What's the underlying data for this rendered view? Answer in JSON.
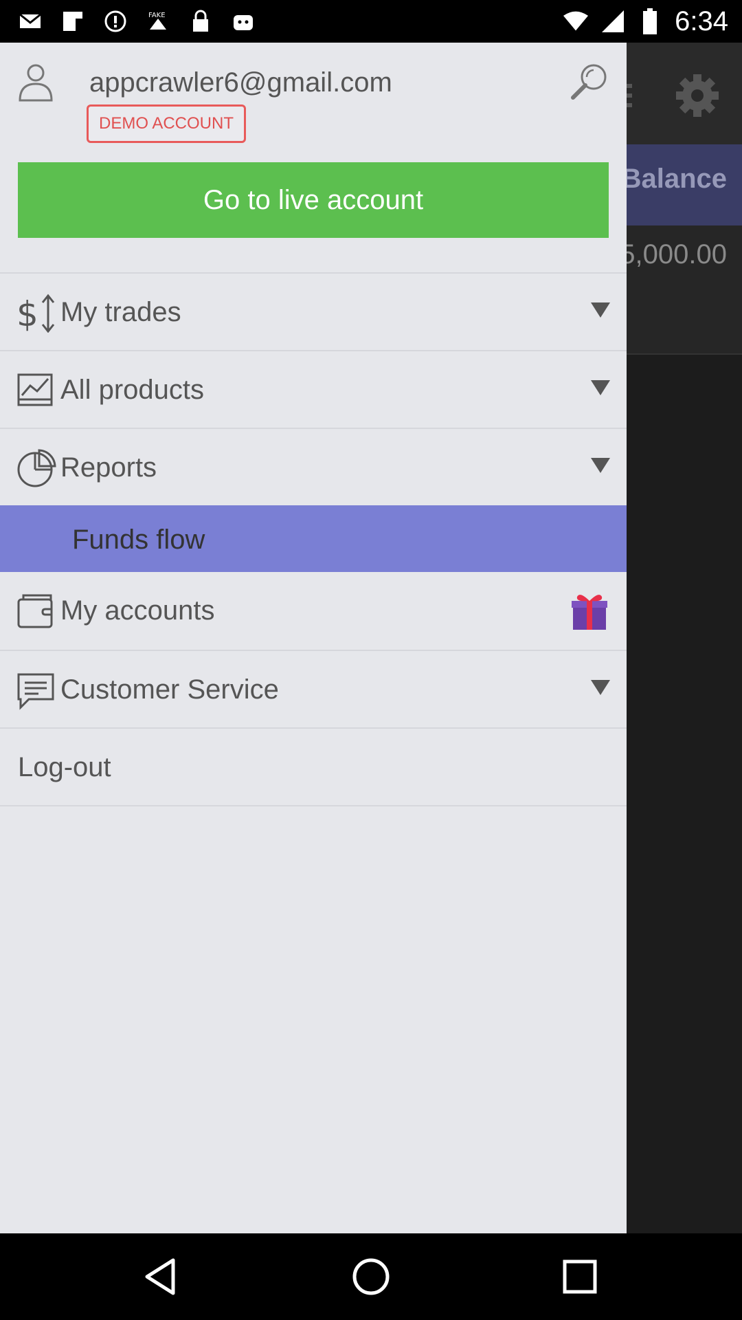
{
  "status_bar": {
    "time": "6:34",
    "icons": [
      "mail-icon",
      "flipboard-icon",
      "alert-icon",
      "fake-gps-icon",
      "lock-icon",
      "android-icon",
      "wifi-icon",
      "signal-icon",
      "battery-icon"
    ]
  },
  "background_app": {
    "balance_label": "Balance",
    "balance_value": "5,000.00"
  },
  "drawer": {
    "email": "appcrawler6@gmail.com",
    "account_badge": "DEMO ACCOUNT",
    "live_button": "Go to live account",
    "items": [
      {
        "label": "My trades",
        "icon": "dollar-updown-icon",
        "trailing": "caret"
      },
      {
        "label": "All products",
        "icon": "chart-icon",
        "trailing": "caret"
      },
      {
        "label": "Reports",
        "icon": "pie-chart-icon",
        "trailing": "caret"
      },
      {
        "label": "Funds flow",
        "icon": "",
        "trailing": "none"
      },
      {
        "label": "My accounts",
        "icon": "wallet-icon",
        "trailing": "gift"
      },
      {
        "label": "Customer Service",
        "icon": "chat-icon",
        "trailing": "caret"
      },
      {
        "label": "Log-out",
        "icon": "",
        "trailing": "none"
      }
    ]
  },
  "colors": {
    "live_button": "#5cbf4f",
    "active_item": "#7a7fd4",
    "badge": "#e85a5a",
    "drawer_bg": "#e6e7eb"
  }
}
